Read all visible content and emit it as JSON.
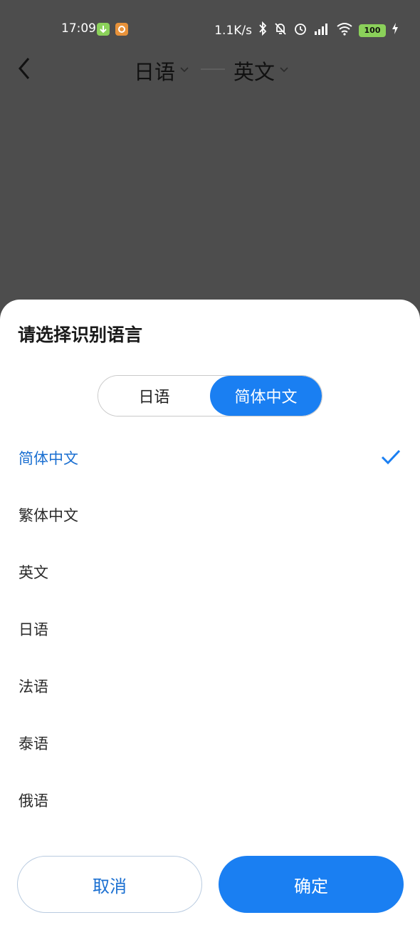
{
  "status_bar": {
    "time": "17:09",
    "net_speed": "1.1K/s",
    "battery": "100"
  },
  "nav": {
    "source_lang": "日语",
    "target_lang": "英文"
  },
  "sheet": {
    "title": "请选择识别语言",
    "segment_left": "日语",
    "segment_right": "简体中文",
    "languages": [
      {
        "label": "简体中文",
        "selected": true
      },
      {
        "label": "繁体中文",
        "selected": false
      },
      {
        "label": "英文",
        "selected": false
      },
      {
        "label": "日语",
        "selected": false
      },
      {
        "label": "法语",
        "selected": false
      },
      {
        "label": "泰语",
        "selected": false
      },
      {
        "label": "俄语",
        "selected": false
      }
    ],
    "cancel_label": "取消",
    "confirm_label": "确定"
  },
  "colors": {
    "accent": "#1a7ff2",
    "overlay": "#4d4d4d",
    "selected_text": "#1a6fd1"
  }
}
